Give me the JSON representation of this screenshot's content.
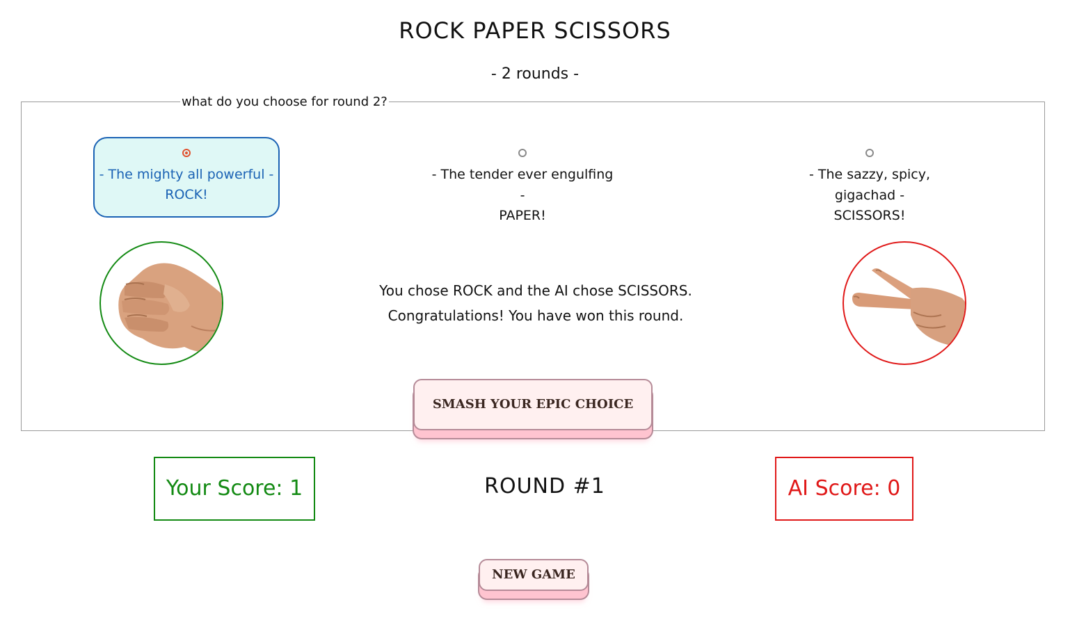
{
  "title": "ROCK PAPER SCISSORS",
  "subtitle": "- 2 rounds -",
  "form": {
    "legend": "what do you choose for round 2?",
    "options": [
      {
        "line1": "- The mighty all powerful -",
        "line2": "ROCK!",
        "selected": true
      },
      {
        "line1": "- The tender ever engulfing -",
        "line2": "PAPER!",
        "selected": false
      },
      {
        "line1": "- The sazzy, spicy, gigachad -",
        "line2": "SCISSORS!",
        "selected": false
      }
    ],
    "result_line1": "You chose ROCK and the AI chose SCISSORS.",
    "result_line2": "Congratulations! You have won this round.",
    "submit_label": "SMASH YOUR EPIC CHOICE"
  },
  "player_hand": "rock-hand-image",
  "ai_hand": "scissors-hand-image",
  "scores": {
    "you_label": "Your Score: 1",
    "round_label": "ROUND #1",
    "ai_label": "AI Score: 0"
  },
  "new_game_label": "NEW GAME",
  "colors": {
    "selected_bg": "#dff8f6",
    "selected_border": "#1a62b4",
    "radio_accent": "#e0522f",
    "win_green": "#138a13",
    "lose_red": "#e01818",
    "button_face": "#fff0f0",
    "button_base": "#ffc4d0"
  }
}
